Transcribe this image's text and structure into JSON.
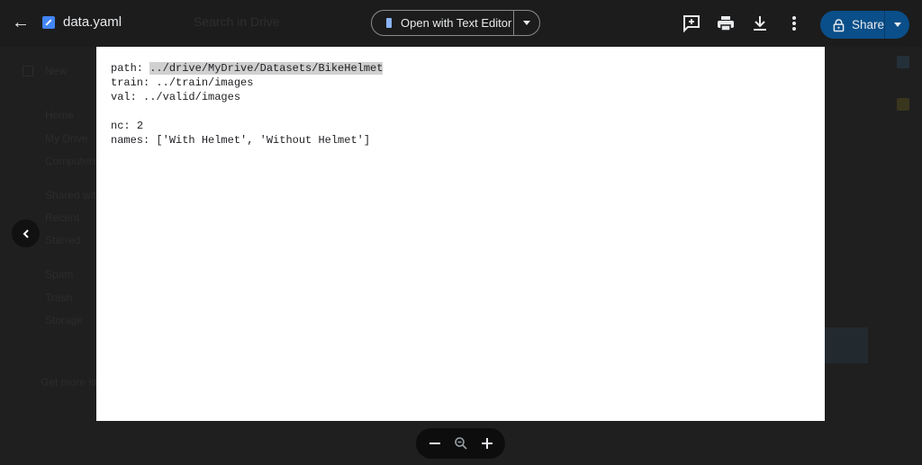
{
  "header": {
    "file_name": "data.yaml",
    "search_placeholder": "Search in Drive",
    "open_with_label": "Open with Text Editor",
    "share_label": "Share",
    "icons": [
      "back-arrow-icon",
      "yaml-file-icon",
      "add-comment-icon",
      "print-icon",
      "download-icon",
      "more-vert-icon",
      "lock-icon",
      "chevron-down-icon"
    ]
  },
  "background_sidebar": {
    "items": [
      "New",
      "Home",
      "My Drive",
      "Computers",
      "Shared with me",
      "Recent",
      "Starred",
      "Spam",
      "Trash",
      "Storage",
      "Get more storage"
    ]
  },
  "document": {
    "lines": [
      {
        "key": "path: ",
        "value": "../drive/MyDrive/Datasets/BikeHelmet",
        "highlighted": true
      },
      {
        "key": "train: ",
        "value": "../train/images"
      },
      {
        "key": "val: ",
        "value": "../valid/images"
      },
      {
        "key": "",
        "value": ""
      },
      {
        "key": "nc: ",
        "value": "2"
      },
      {
        "key": "names: ",
        "value": "['With Helmet', 'Without Helmet']"
      }
    ]
  },
  "zoom_controls": {
    "icons": [
      "zoom-out-icon",
      "zoom-reset-icon",
      "zoom-in-icon"
    ]
  },
  "colors": {
    "share_button": "#0a4f8a",
    "highlight": "#d0d0d0",
    "background": "#1f1f1f"
  }
}
